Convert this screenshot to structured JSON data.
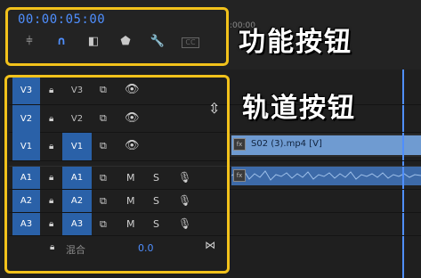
{
  "timecode": "00:00:05:00",
  "tools": [
    {
      "icon": "insert-edit-icon",
      "glyph": "⫩"
    },
    {
      "icon": "snap-magnet-icon",
      "glyph": "∩"
    },
    {
      "icon": "linked-selection-icon",
      "glyph": "◧"
    },
    {
      "icon": "add-marker-icon",
      "glyph": "⬟"
    },
    {
      "icon": "settings-wrench-icon",
      "glyph": "🔧"
    },
    {
      "icon": "captions-icon",
      "glyph": "CC"
    }
  ],
  "ruler_label": ":00:00",
  "captions": {
    "function_buttons": "功能按钮",
    "track_buttons": "轨道按钮"
  },
  "video_tracks": [
    {
      "source": "V3",
      "target": "V3",
      "target_selected": false
    },
    {
      "source": "V2",
      "target": "V2",
      "target_selected": false
    },
    {
      "source": "V1",
      "target": "V1",
      "target_selected": true
    }
  ],
  "audio_tracks": [
    {
      "source": "A1",
      "target": "A1",
      "mute": "M",
      "solo": "S"
    },
    {
      "source": "A2",
      "target": "A2",
      "mute": "M",
      "solo": "S"
    },
    {
      "source": "A3",
      "target": "A3",
      "mute": "M",
      "solo": "S"
    }
  ],
  "mix": {
    "label": "混合",
    "value": "0.0"
  },
  "clip": {
    "name": "S02 (3).mp4 [V]",
    "fx_badge": "fx"
  },
  "colors": {
    "accent": "#2a61a8",
    "highlight": "#f2c21b",
    "timecode": "#4f8fff",
    "clip_video": "#6f9bd1",
    "clip_audio": "#3d6aa8"
  }
}
